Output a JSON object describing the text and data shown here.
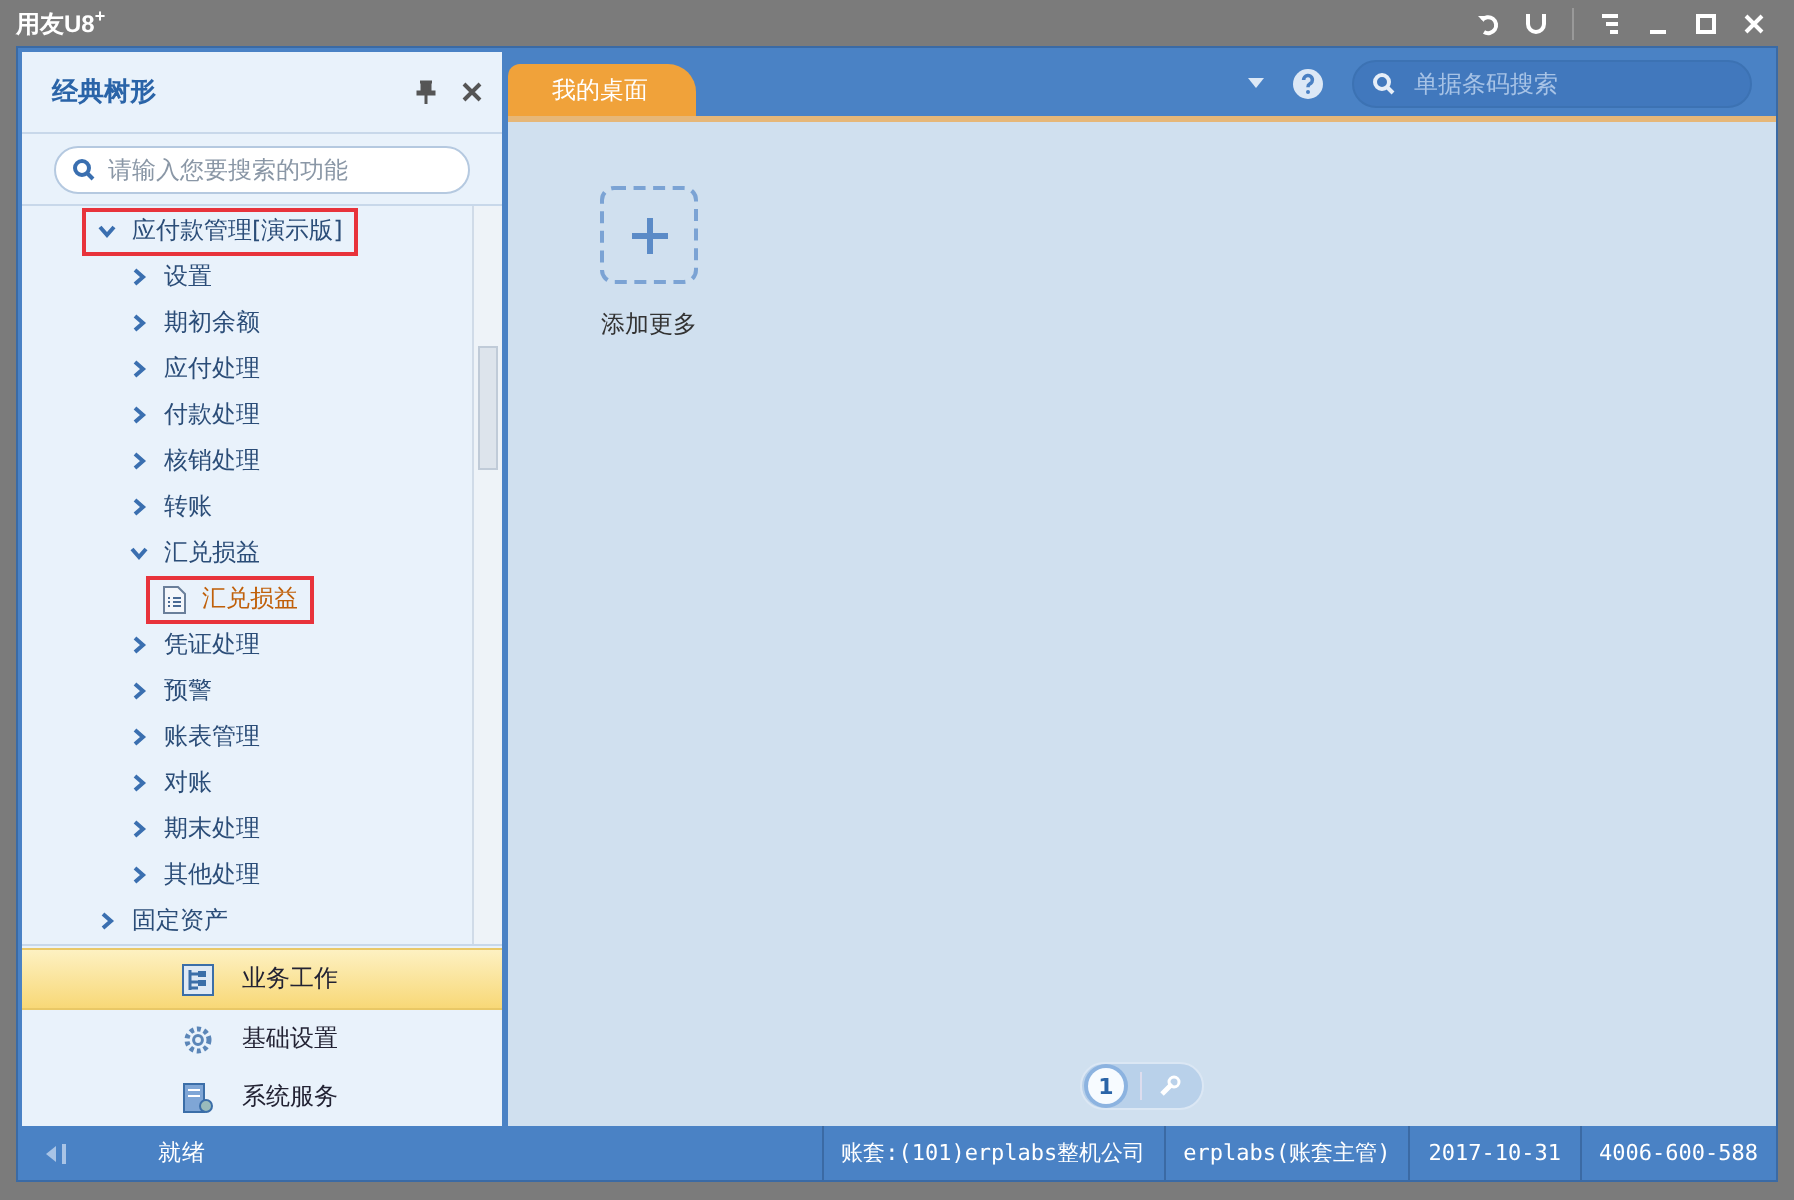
{
  "window": {
    "title": "用友U8",
    "title_sup": "+"
  },
  "sidebar": {
    "title": "经典树形",
    "search": {
      "placeholder": "请输入您要搜索的功能"
    },
    "tree": [
      {
        "label": "应付款管理[演示版]",
        "expanded": true,
        "highlighted": true,
        "selected": false,
        "children": [
          {
            "label": "设置",
            "expanded": false,
            "highlighted": false,
            "selected": false
          },
          {
            "label": "期初余额",
            "expanded": false,
            "highlighted": false,
            "selected": false
          },
          {
            "label": "应付处理",
            "expanded": false,
            "highlighted": false,
            "selected": false
          },
          {
            "label": "付款处理",
            "expanded": false,
            "highlighted": false,
            "selected": false
          },
          {
            "label": "核销处理",
            "expanded": false,
            "highlighted": false,
            "selected": false
          },
          {
            "label": "转账",
            "expanded": false,
            "highlighted": false,
            "selected": false
          },
          {
            "label": "汇兑损益",
            "expanded": true,
            "highlighted": false,
            "selected": false,
            "children": [
              {
                "label": "汇兑损益",
                "kind": "leaf",
                "highlighted": true,
                "selected": true
              }
            ]
          },
          {
            "label": "凭证处理",
            "expanded": false,
            "highlighted": false,
            "selected": false
          },
          {
            "label": "预警",
            "expanded": false,
            "highlighted": false,
            "selected": false
          },
          {
            "label": "账表管理",
            "expanded": false,
            "highlighted": false,
            "selected": false
          },
          {
            "label": "对账",
            "expanded": false,
            "highlighted": false,
            "selected": false
          },
          {
            "label": "期末处理",
            "expanded": false,
            "highlighted": false,
            "selected": false
          },
          {
            "label": "其他处理",
            "expanded": false,
            "highlighted": false,
            "selected": false
          }
        ]
      },
      {
        "label": "固定资产",
        "expanded": false,
        "highlighted": false,
        "selected": false
      }
    ],
    "nav": [
      {
        "label": "业务工作",
        "kind": "tree",
        "selected": true
      },
      {
        "label": "基础设置",
        "kind": "gear",
        "selected": false
      },
      {
        "label": "系统服务",
        "kind": "server",
        "selected": false
      }
    ]
  },
  "tabs": [
    {
      "label": "我的桌面",
      "selected": true
    }
  ],
  "search": {
    "placeholder": "单据条码搜索"
  },
  "desktop": {
    "add_label": "添加更多"
  },
  "pager": [
    {
      "label": "1",
      "selected": true
    }
  ],
  "status_bar": {
    "status": "就绪",
    "account": "账套:(101)erplabs整机公司",
    "user": "erplabs(账套主管)",
    "date": "2017-10-31",
    "phone": "4006-600-588"
  }
}
